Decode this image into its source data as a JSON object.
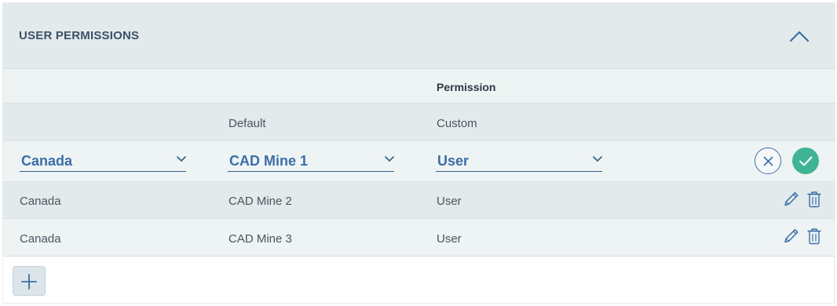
{
  "section": {
    "title": "USER PERMISSIONS",
    "collapse_icon": "chevron-up-icon"
  },
  "table": {
    "group_header": "Permission",
    "columns": [
      "Default",
      "Custom"
    ]
  },
  "edit_row": {
    "country": "Canada",
    "default": "CAD Mine 1",
    "custom": "User",
    "cancel_icon": "close-icon",
    "confirm_icon": "check-icon"
  },
  "rows": [
    {
      "country": "Canada",
      "default": "CAD Mine 2",
      "custom": "User"
    },
    {
      "country": "Canada",
      "default": "CAD Mine 3",
      "custom": "User"
    }
  ],
  "row_actions": [
    "pencil-icon",
    "trash-icon"
  ],
  "add_icon": "plus-icon",
  "colors": {
    "header_bg": "#e3eaeb",
    "accent_blue": "#3b6fa8",
    "title_text": "#3a5168",
    "confirm_green": "#3fb494"
  }
}
